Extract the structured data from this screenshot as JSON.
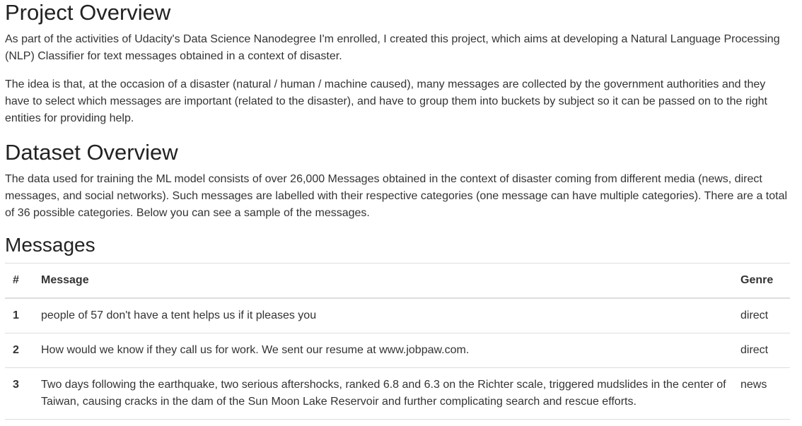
{
  "project": {
    "title": "Project Overview",
    "paragraph_1": "As part of the activities of Udacity's Data Science Nanodegree I'm enrolled, I created this project, which aims at developing a Natural Language Processing (NLP) Classifier for text messages obtained in a context of disaster.",
    "paragraph_2": "The idea is that, at the occasion of a disaster (natural / human / machine caused), many messages are collected by the government authorities and they have to select which messages are important (related to the disaster), and have to group them into buckets by subject so it can be passed on to the right entities for providing help."
  },
  "dataset": {
    "title": "Dataset Overview",
    "paragraph": "The data used for training the ML model consists of over 26,000 Messages obtained in the context of disaster coming from different media (news, direct messages, and social networks). Such messages are labelled with their respective categories (one message can have multiple categories). There are a total of 36 possible categories. Below you can see a sample of the messages."
  },
  "messages": {
    "title": "Messages",
    "columns": [
      "#",
      "Message",
      "Genre"
    ],
    "rows": [
      {
        "num": "1",
        "message": "people of 57 don't have a tent helps us if it pleases you",
        "genre": "direct"
      },
      {
        "num": "2",
        "message": "How would we know if they call us for work. We sent our resume at www.jobpaw.com.",
        "genre": "direct"
      },
      {
        "num": "3",
        "message": "Two days following the earthquake, two serious aftershocks, ranked 6.8 and 6.3 on the Richter scale, triggered mudslides in the center of Taiwan, causing cracks in the dam of the Sun Moon Lake Reservoir and further complicating search and rescue efforts.",
        "genre": "news"
      }
    ]
  }
}
